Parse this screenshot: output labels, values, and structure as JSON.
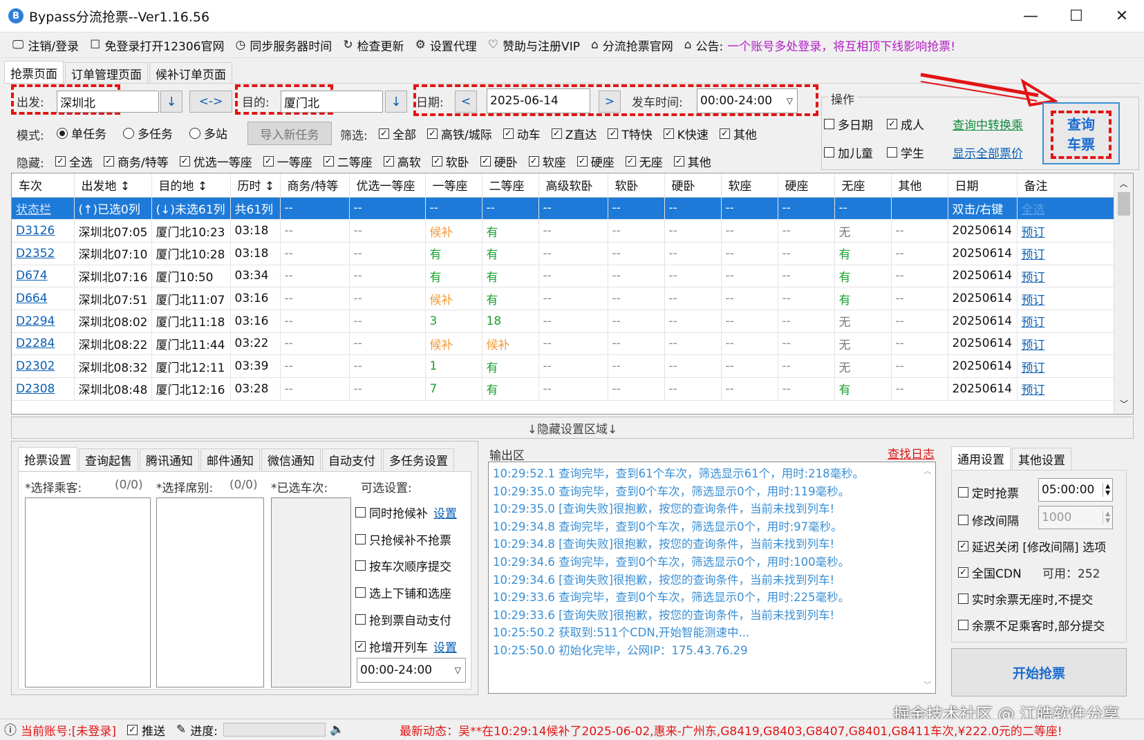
{
  "window": {
    "title": "Bypass分流抢票--Ver1.16.56",
    "minimize": "—",
    "maximize": "☐",
    "close": "✕"
  },
  "toolbar": {
    "items": [
      {
        "icon": "🖵",
        "label": "注销/登录",
        "name": "logout-login"
      },
      {
        "icon": "☐",
        "label": "免登录打开12306官网",
        "name": "open-12306"
      },
      {
        "icon": "◷",
        "label": "同步服务器时间",
        "name": "sync-time"
      },
      {
        "icon": "↻",
        "label": "检查更新",
        "name": "check-update"
      },
      {
        "icon": "⚙",
        "label": "设置代理",
        "name": "set-proxy"
      },
      {
        "icon": "♡",
        "label": "赞助与注册VIP",
        "name": "sponsor-vip"
      },
      {
        "icon": "⌂",
        "label": "分流抢票官网",
        "name": "official-site"
      }
    ],
    "notice_label": "公告:",
    "notice_text": "一个账号多处登录，将互相顶下线影响抢票!"
  },
  "tabs": [
    "抢票页面",
    "订单管理页面",
    "候补订单页面"
  ],
  "query": {
    "from_label": "出发:",
    "from_value": "深圳北",
    "swap": "<->",
    "to_label": "目的:",
    "to_value": "厦门北",
    "date_label": "日期:",
    "date_value": "2025-06-14",
    "prev": "<",
    "next": ">",
    "time_label": "发车时间:",
    "time_value": "00:00-24:00",
    "down_arrow": "↓"
  },
  "mode": {
    "label": "模式:",
    "options": [
      "单任务",
      "多任务",
      "多站"
    ],
    "selected": "单任务",
    "import_btn": "导入新任务"
  },
  "filter": {
    "label": "筛选:",
    "items": [
      "全部",
      "高铁/城际",
      "动车",
      "Z直达",
      "T特快",
      "K快速",
      "其他"
    ]
  },
  "hide": {
    "label": "隐藏:",
    "items": [
      "全选",
      "商务/特等",
      "优选一等座",
      "一等座",
      "二等座",
      "高软",
      "软卧",
      "硬卧",
      "软座",
      "硬座",
      "无座",
      "其他"
    ]
  },
  "ops": {
    "title": "操作",
    "multi_date": "多日期",
    "adult": "成人",
    "add_child": "加儿童",
    "student": "学生",
    "query_transfer": "查询中转换乘",
    "show_all_price": "显示全部票价",
    "query_btn_line1": "查询",
    "query_btn_line2": "车票"
  },
  "grid": {
    "headers": [
      "车次",
      "出发地 ↕",
      "目的地 ↕",
      "历时 ↕",
      "商务/特等",
      "优选一等座",
      "一等座",
      "二等座",
      "高级软卧",
      "软卧",
      "硬卧",
      "软座",
      "硬座",
      "无座",
      "其他",
      "日期",
      "备注"
    ],
    "status_row": [
      "状态栏",
      "(↑)已选0列",
      "(↓)未选61列",
      "共61列",
      "--",
      "--",
      "--",
      "--",
      "--",
      "--",
      "--",
      "--",
      "--",
      "--",
      "",
      "双击/右键",
      "全选"
    ],
    "rows": [
      [
        "D3126",
        "深圳北07:05",
        "厦门北10:23",
        "03:18",
        "--",
        "--",
        "候补",
        "有",
        "--",
        "--",
        "--",
        "--",
        "--",
        "无",
        "--",
        "20250614",
        "预订"
      ],
      [
        "D2352",
        "深圳北07:10",
        "厦门北10:28",
        "03:18",
        "--",
        "--",
        "有",
        "有",
        "--",
        "--",
        "--",
        "--",
        "--",
        "有",
        "--",
        "20250614",
        "预订"
      ],
      [
        "D674",
        "深圳北07:16",
        "厦门10:50",
        "03:34",
        "--",
        "--",
        "有",
        "有",
        "--",
        "--",
        "--",
        "--",
        "--",
        "有",
        "--",
        "20250614",
        "预订"
      ],
      [
        "D664",
        "深圳北07:51",
        "厦门北11:07",
        "03:16",
        "--",
        "--",
        "候补",
        "有",
        "--",
        "--",
        "--",
        "--",
        "--",
        "有",
        "--",
        "20250614",
        "预订"
      ],
      [
        "D2294",
        "深圳北08:02",
        "厦门北11:18",
        "03:16",
        "--",
        "--",
        "3",
        "18",
        "--",
        "--",
        "--",
        "--",
        "--",
        "无",
        "--",
        "20250614",
        "预订"
      ],
      [
        "D2284",
        "深圳北08:22",
        "厦门北11:44",
        "03:22",
        "--",
        "--",
        "候补",
        "候补",
        "--",
        "--",
        "--",
        "--",
        "--",
        "无",
        "--",
        "20250614",
        "预订"
      ],
      [
        "D2302",
        "深圳北08:32",
        "厦门北12:11",
        "03:39",
        "--",
        "--",
        "1",
        "有",
        "--",
        "--",
        "--",
        "--",
        "--",
        "无",
        "--",
        "20250614",
        "预订"
      ],
      [
        "D2308",
        "深圳北08:48",
        "厦门北12:16",
        "03:28",
        "--",
        "--",
        "7",
        "有",
        "--",
        "--",
        "--",
        "--",
        "--",
        "有",
        "--",
        "20250614",
        "预订"
      ]
    ]
  },
  "hidden_area": "↓隐藏设置区域↓",
  "left_tabs": [
    "抢票设置",
    "查询起售",
    "腾讯通知",
    "邮件通知",
    "微信通知",
    "自动支付",
    "多任务设置"
  ],
  "passengers": {
    "label": "*选择乘客:",
    "count": "(0/0)"
  },
  "seats": {
    "label": "*选择席别:",
    "count": "(0/0)"
  },
  "trains": {
    "label": "*已选车次:"
  },
  "options": {
    "title": "可选设置:",
    "items": [
      {
        "label": "同时抢候补",
        "checked": false,
        "link": "设置"
      },
      {
        "label": "只抢候补不抢票",
        "checked": false,
        "link": ""
      },
      {
        "label": "按车次顺序提交",
        "checked": false,
        "link": ""
      },
      {
        "label": "选上下铺和选座",
        "checked": false,
        "link": ""
      },
      {
        "label": "抢到票自动支付",
        "checked": false,
        "link": ""
      },
      {
        "label": "抢增开列车",
        "checked": true,
        "link": "设置"
      }
    ],
    "time_range": "00:00-24:00"
  },
  "output": {
    "title": "输出区",
    "find_log": "查找日志",
    "lines": [
      "10:29:52.1  查询完毕，查到61个车次，筛选显示61个，用时:218毫秒。",
      "10:29:35.0  查询完毕，查到0个车次，筛选显示0个，用时:119毫秒。",
      "10:29:35.0  [查询失败]很抱歉，按您的查询条件，当前未找到列车!",
      "10:29:34.8  查询完毕，查到0个车次，筛选显示0个，用时:97毫秒。",
      "10:29:34.8  [查询失败]很抱歉，按您的查询条件，当前未找到列车!",
      "10:29:34.6  查询完毕，查到0个车次，筛选显示0个，用时:100毫秒。",
      "10:29:34.6  [查询失败]很抱歉，按您的查询条件，当前未找到列车!",
      "10:29:33.6  查询完毕，查到0个车次，筛选显示0个，用时:225毫秒。",
      "10:29:33.6  [查询失败]很抱歉，按您的查询条件，当前未找到列车!",
      "10:25:50.2  获取到:511个CDN,开始智能测速中...",
      "10:25:50.0  初始化完毕，公网IP：175.43.76.29"
    ]
  },
  "right_tabs": [
    "通用设置",
    "其他设置"
  ],
  "general": {
    "timed": "定时抢票",
    "timed_value": "05:00:00",
    "interval": "修改间隔",
    "interval_value": "1000",
    "delay_close": "延迟关闭 [修改间隔] 选项",
    "cdn": "全国CDN",
    "cdn_avail": "可用：252",
    "no_seat": "实时余票无座时,不提交",
    "partial": "余票不足乘客时,部分提交",
    "start_btn": "开始抢票"
  },
  "status": {
    "account": "当前账号:[未登录]",
    "push": "推送",
    "progress": "进度:",
    "news_label": "最新动态：",
    "news_text": "吴**在10:29:14候补了2025-06-02,惠来-广州东,G8419,G8403,G8407,G8401,G8411车次,¥222.0元的二等座!"
  },
  "watermark": "掘金技术社区 @ 江皓软件分享"
}
